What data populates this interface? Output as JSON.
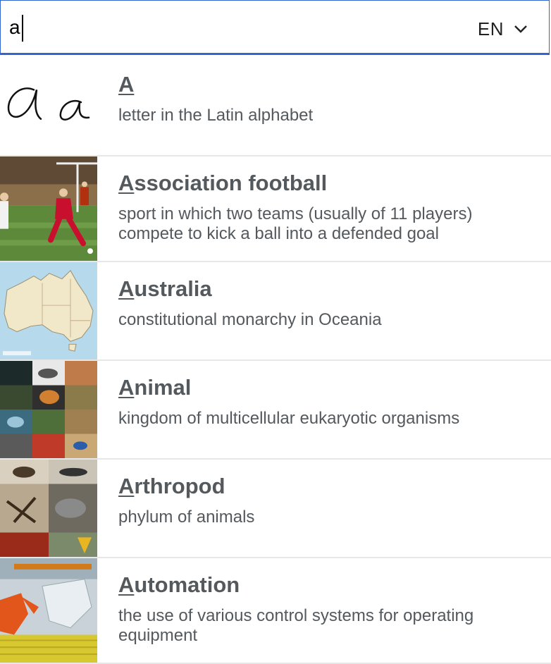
{
  "search": {
    "value": "a",
    "language": "EN"
  },
  "results": [
    {
      "match": "A",
      "rest": "",
      "description": "letter in the Latin alphabet"
    },
    {
      "match": "A",
      "rest": "ssociation football",
      "description": "sport in which two teams (usually of 11 players) compete to kick a ball into a defended goal"
    },
    {
      "match": "A",
      "rest": "ustralia",
      "description": "constitutional monarchy in Oceania"
    },
    {
      "match": "A",
      "rest": "nimal",
      "description": "kingdom of multicellular eukaryotic organisms"
    },
    {
      "match": "A",
      "rest": "rthropod",
      "description": "phylum of animals"
    },
    {
      "match": "A",
      "rest": "utomation",
      "description": "the use of various control systems for operating equipment"
    }
  ],
  "colors": {
    "accent": "#3366cc",
    "text": "#54595d",
    "divider": "#e7e7e7"
  },
  "icons": {
    "language_dropdown": "chevron-down-icon"
  }
}
